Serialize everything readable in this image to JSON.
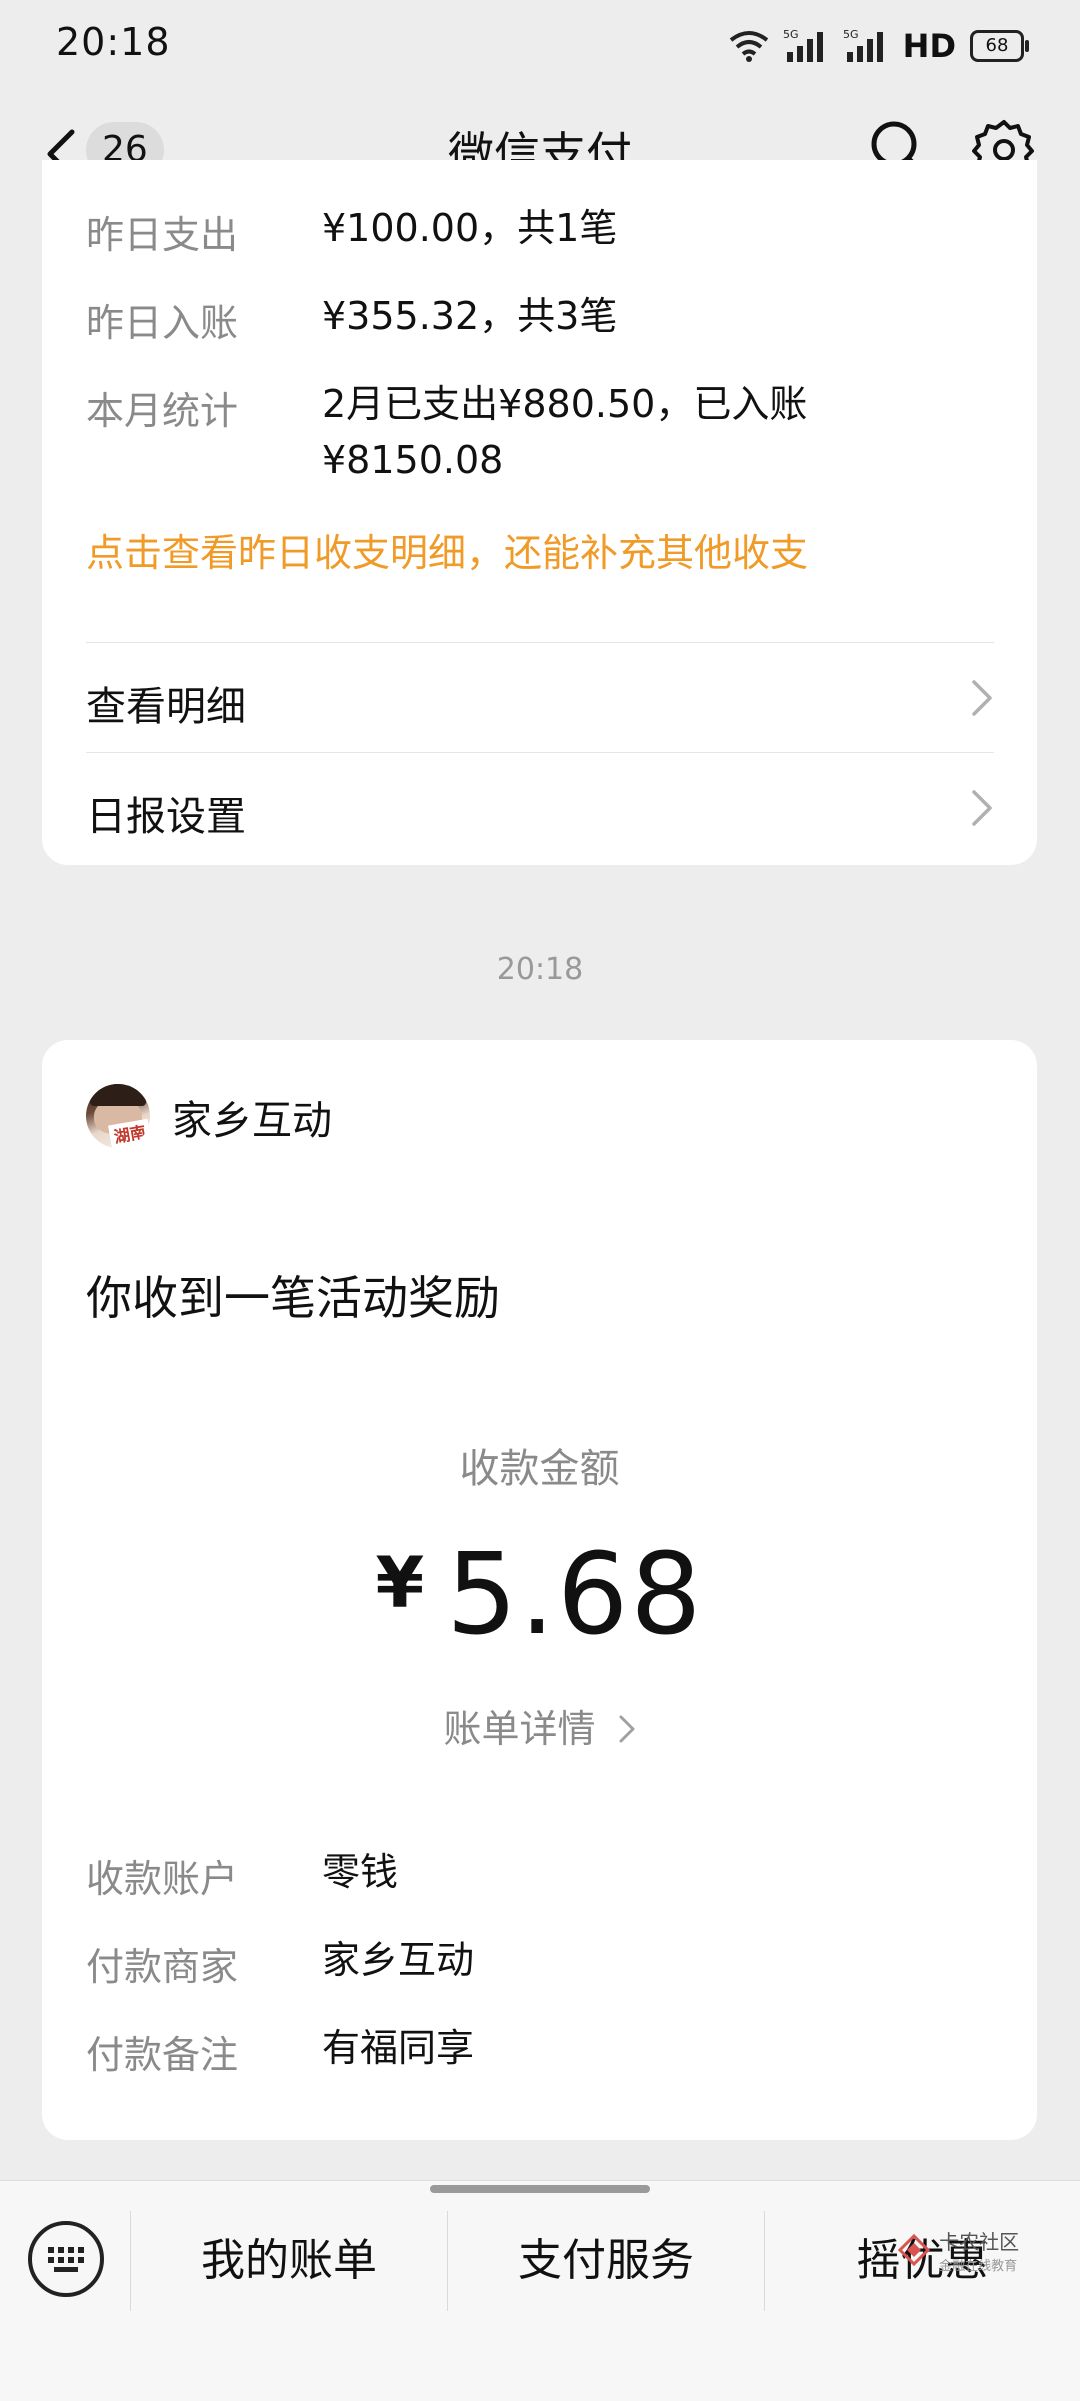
{
  "status_bar": {
    "time": "20:18",
    "network": "5G",
    "hd_label": "HD",
    "battery": "68"
  },
  "header": {
    "unread_count": "26",
    "title": "微信支付"
  },
  "daily_report": {
    "rows": [
      {
        "label": "昨日支出",
        "value": "¥100.00，共1笔"
      },
      {
        "label": "昨日入账",
        "value": "¥355.32，共3笔"
      },
      {
        "label": "本月统计",
        "value_line1": "2月已支出¥880.50，已入账",
        "value_line2": "¥8150.08"
      }
    ],
    "tip": "点击查看昨日收支明细，还能补充其他收支",
    "menu": [
      {
        "label": "查看明细"
      },
      {
        "label": "日报设置"
      }
    ]
  },
  "timestamp": "20:18",
  "receipt": {
    "merchant": "家乡互动",
    "avatar_text": "湖南",
    "title": "你收到一笔活动奖励",
    "amount_label": "收款金额",
    "currency": "¥",
    "amount": "5.68",
    "detail_link": "账单详情",
    "info_rows": [
      {
        "label": "收款账户",
        "value": "零钱"
      },
      {
        "label": "付款商家",
        "value": "家乡互动"
      },
      {
        "label": "付款备注",
        "value": "有福同享"
      }
    ]
  },
  "bottom_bar": {
    "tabs": [
      "我的账单",
      "支付服务",
      "摇优惠"
    ]
  },
  "watermark": {
    "title": "卡农社区",
    "subtitle": "金融在线教育"
  },
  "colors": {
    "accent_orange": "#f09a27",
    "background": "#ededed",
    "card": "#ffffff"
  }
}
